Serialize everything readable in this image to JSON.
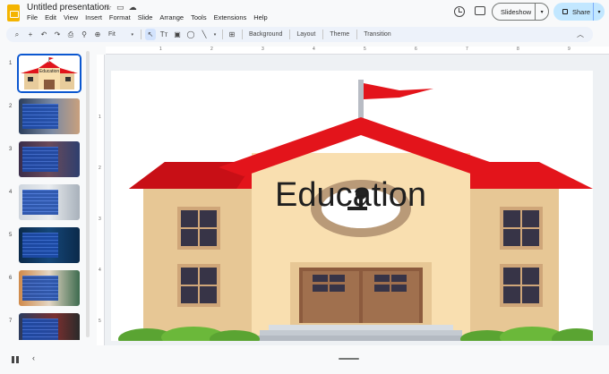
{
  "app": {
    "title": "Untitled presentation",
    "title_icons": [
      "star-icon",
      "move-to-folder-icon",
      "cloud-status-icon"
    ],
    "menus": [
      "File",
      "Edit",
      "View",
      "Insert",
      "Format",
      "Slide",
      "Arrange",
      "Tools",
      "Extensions",
      "Help"
    ]
  },
  "header": {
    "slideshow_label": "Slideshow",
    "share_label": "Share",
    "accent": "#c2e7ff"
  },
  "toolbar": {
    "zoom_label": "Fit",
    "background_label": "Background",
    "layout_label": "Layout",
    "theme_label": "Theme",
    "transition_label": "Transition"
  },
  "filmstrip": {
    "slides": [
      {
        "number": "1",
        "selected": true
      },
      {
        "number": "2"
      },
      {
        "number": "3"
      },
      {
        "number": "4"
      },
      {
        "number": "5"
      },
      {
        "number": "6"
      },
      {
        "number": "7"
      }
    ]
  },
  "ruler": {
    "top": [
      "1",
      "2",
      "3",
      "4",
      "5",
      "6",
      "7",
      "8",
      "9"
    ],
    "left": [
      "1",
      "2",
      "3",
      "4",
      "5"
    ]
  },
  "slide": {
    "title": "Education"
  }
}
